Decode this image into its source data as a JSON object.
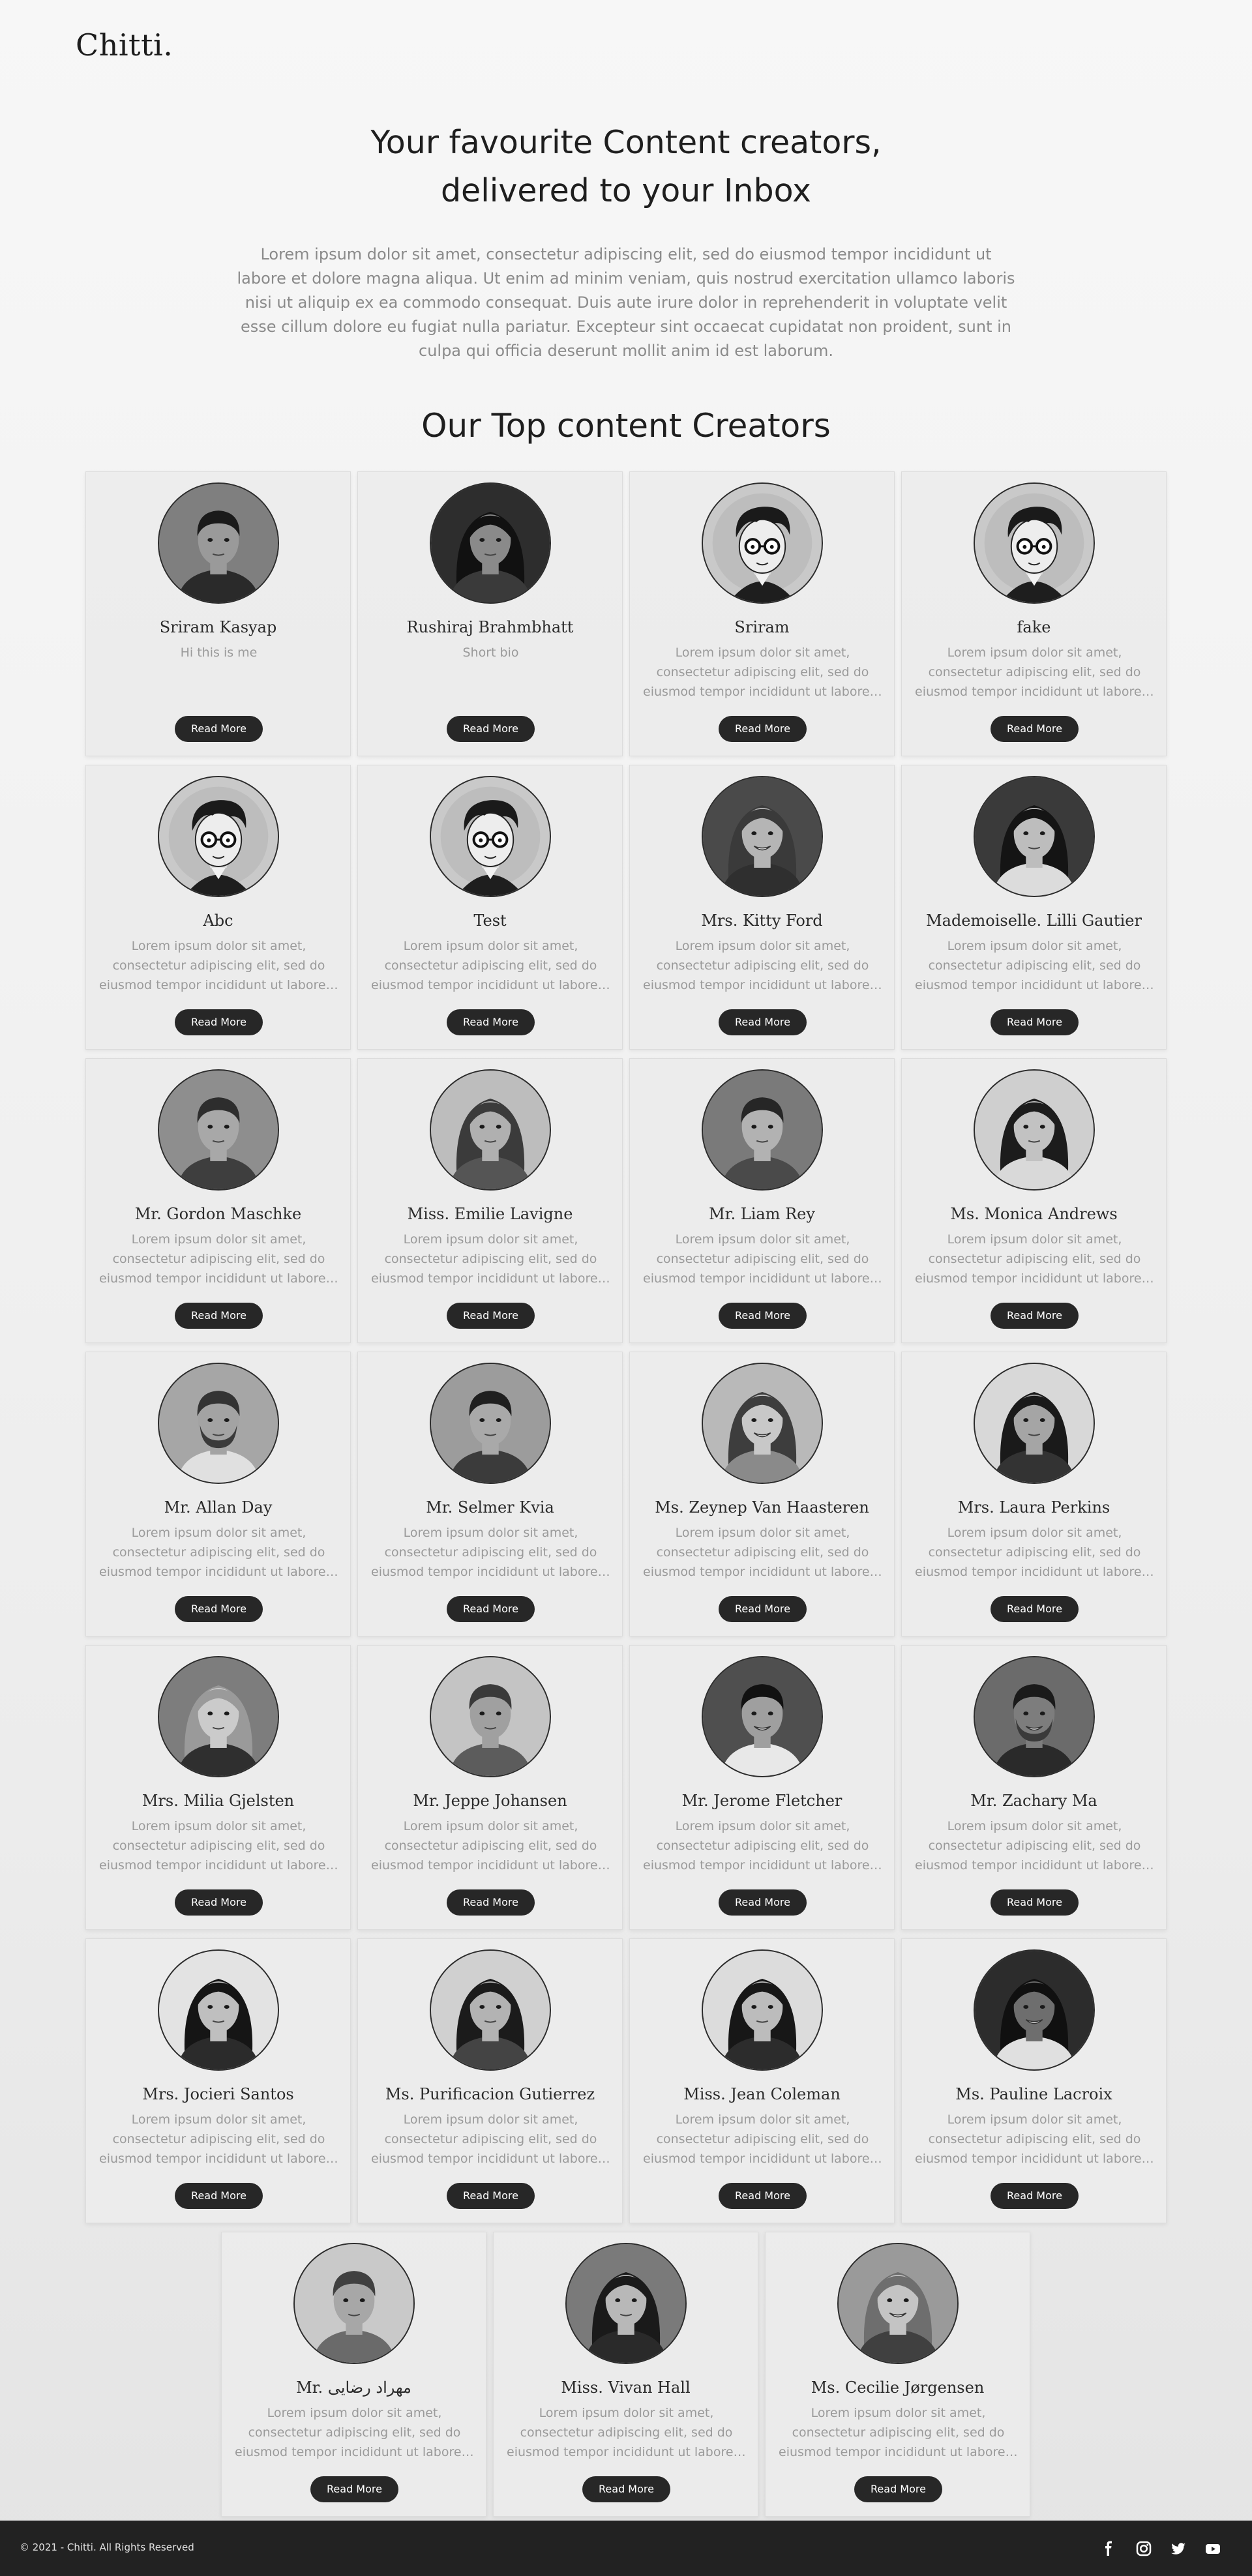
{
  "header": {
    "logo": "Chitti."
  },
  "hero": {
    "title_line1": "Your favourite Content creators,",
    "title_line2": "delivered to your Inbox",
    "description": "Lorem ipsum dolor sit amet, consectetur adipiscing elit, sed do eiusmod tempor incididunt ut labore et dolore magna aliqua. Ut enim ad minim veniam, quis nostrud exercitation ullamco laboris nisi ut aliquip ex ea commodo consequat. Duis aute irure dolor in reprehenderit in voluptate velit esse cillum dolore eu fugiat nulla pariatur. Excepteur sint occaecat cupidatat non proident, sunt in culpa qui officia deserunt mollit anim id est laborum."
  },
  "section": {
    "title": "Our Top content Creators"
  },
  "read_more_label": "Read More",
  "creators": [
    {
      "name": "Sriram Kasyap",
      "bio": [
        "Hi this is me"
      ]
    },
    {
      "name": "Rushiraj Brahmbhatt",
      "bio": [
        "Short bio"
      ]
    },
    {
      "name": "Sriram",
      "bio": [
        "Lorem ipsum dolor sit amet,",
        "consectetur adipiscing elit, sed do",
        "eiusmod tempor incididunt ut labore e..."
      ]
    },
    {
      "name": "fake",
      "bio": [
        "Lorem ipsum dolor sit amet,",
        "consectetur adipiscing elit, sed do",
        "eiusmod tempor incididunt ut labore e..."
      ]
    },
    {
      "name": "Abc",
      "bio": [
        "Lorem ipsum dolor sit amet,",
        "consectetur adipiscing elit, sed do",
        "eiusmod tempor incididunt ut labore e..."
      ]
    },
    {
      "name": "Test",
      "bio": [
        "Lorem ipsum dolor sit amet,",
        "consectetur adipiscing elit, sed do",
        "eiusmod tempor incididunt ut labore e..."
      ]
    },
    {
      "name": "Mrs. Kitty Ford",
      "bio": [
        "Lorem ipsum dolor sit amet,",
        "consectetur adipiscing elit, sed do",
        "eiusmod tempor incididunt ut labore e..."
      ]
    },
    {
      "name": "Mademoiselle. Lilli Gautier",
      "bio": [
        "Lorem ipsum dolor sit amet,",
        "consectetur adipiscing elit, sed do",
        "eiusmod tempor incididunt ut labore e..."
      ]
    },
    {
      "name": "Mr. Gordon Maschke",
      "bio": [
        "Lorem ipsum dolor sit amet,",
        "consectetur adipiscing elit, sed do",
        "eiusmod tempor incididunt ut labore e..."
      ]
    },
    {
      "name": "Miss. Emilie Lavigne",
      "bio": [
        "Lorem ipsum dolor sit amet,",
        "consectetur adipiscing elit, sed do",
        "eiusmod tempor incididunt ut labore e..."
      ]
    },
    {
      "name": "Mr. Liam Rey",
      "bio": [
        "Lorem ipsum dolor sit amet,",
        "consectetur adipiscing elit, sed do",
        "eiusmod tempor incididunt ut labore e..."
      ]
    },
    {
      "name": "Ms. Monica Andrews",
      "bio": [
        "Lorem ipsum dolor sit amet,",
        "consectetur adipiscing elit, sed do",
        "eiusmod tempor incididunt ut labore e..."
      ]
    },
    {
      "name": "Mr. Allan Day",
      "bio": [
        "Lorem ipsum dolor sit amet,",
        "consectetur adipiscing elit, sed do",
        "eiusmod tempor incididunt ut labore e..."
      ]
    },
    {
      "name": "Mr. Selmer Kvia",
      "bio": [
        "Lorem ipsum dolor sit amet,",
        "consectetur adipiscing elit, sed do",
        "eiusmod tempor incididunt ut labore e..."
      ]
    },
    {
      "name": "Ms. Zeynep Van Haasteren",
      "bio": [
        "Lorem ipsum dolor sit amet,",
        "consectetur adipiscing elit, sed do",
        "eiusmod tempor incididunt ut labore e..."
      ]
    },
    {
      "name": "Mrs. Laura Perkins",
      "bio": [
        "Lorem ipsum dolor sit amet,",
        "consectetur adipiscing elit, sed do",
        "eiusmod tempor incididunt ut labore e..."
      ]
    },
    {
      "name": "Mrs. Milia Gjelsten",
      "bio": [
        "Lorem ipsum dolor sit amet,",
        "consectetur adipiscing elit, sed do",
        "eiusmod tempor incididunt ut labore e..."
      ]
    },
    {
      "name": "Mr. Jeppe Johansen",
      "bio": [
        "Lorem ipsum dolor sit amet,",
        "consectetur adipiscing elit, sed do",
        "eiusmod tempor incididunt ut labore e..."
      ]
    },
    {
      "name": "Mr. Jerome Fletcher",
      "bio": [
        "Lorem ipsum dolor sit amet,",
        "consectetur adipiscing elit, sed do",
        "eiusmod tempor incididunt ut labore e..."
      ]
    },
    {
      "name": "Mr. Zachary Ma",
      "bio": [
        "Lorem ipsum dolor sit amet,",
        "consectetur adipiscing elit, sed do",
        "eiusmod tempor incididunt ut labore e..."
      ]
    },
    {
      "name": "Mrs. Jocieri Santos",
      "bio": [
        "Lorem ipsum dolor sit amet,",
        "consectetur adipiscing elit, sed do",
        "eiusmod tempor incididunt ut labore e..."
      ]
    },
    {
      "name": "Ms. Purificacion Gutierrez",
      "bio": [
        "Lorem ipsum dolor sit amet,",
        "consectetur adipiscing elit, sed do",
        "eiusmod tempor incididunt ut labore e..."
      ]
    },
    {
      "name": "Miss. Jean Coleman",
      "bio": [
        "Lorem ipsum dolor sit amet,",
        "consectetur adipiscing elit, sed do",
        "eiusmod tempor incididunt ut labore e..."
      ]
    },
    {
      "name": "Ms. Pauline Lacroix",
      "bio": [
        "Lorem ipsum dolor sit amet,",
        "consectetur adipiscing elit, sed do",
        "eiusmod tempor incididunt ut labore e..."
      ]
    },
    {
      "name": "Mr. مهراد رضایی",
      "bio": [
        "Lorem ipsum dolor sit amet,",
        "consectetur adipiscing elit, sed do",
        "eiusmod tempor incididunt ut labore e..."
      ]
    },
    {
      "name": "Miss. Vivan Hall",
      "bio": [
        "Lorem ipsum dolor sit amet,",
        "consectetur adipiscing elit, sed do",
        "eiusmod tempor incididunt ut labore e..."
      ]
    },
    {
      "name": "Ms. Cecilie Jørgensen",
      "bio": [
        "Lorem ipsum dolor sit amet,",
        "consectetur adipiscing elit, sed do",
        "eiusmod tempor incididunt ut labore e..."
      ]
    }
  ],
  "footer": {
    "copyright": "© 2021 - Chitti. All Rights Reserved",
    "social_icons": [
      "facebook-icon",
      "instagram-icon",
      "twitter-icon",
      "youtube-icon"
    ]
  },
  "colors": {
    "button": "#272727",
    "footer": "#222222",
    "card": "#ececec"
  }
}
